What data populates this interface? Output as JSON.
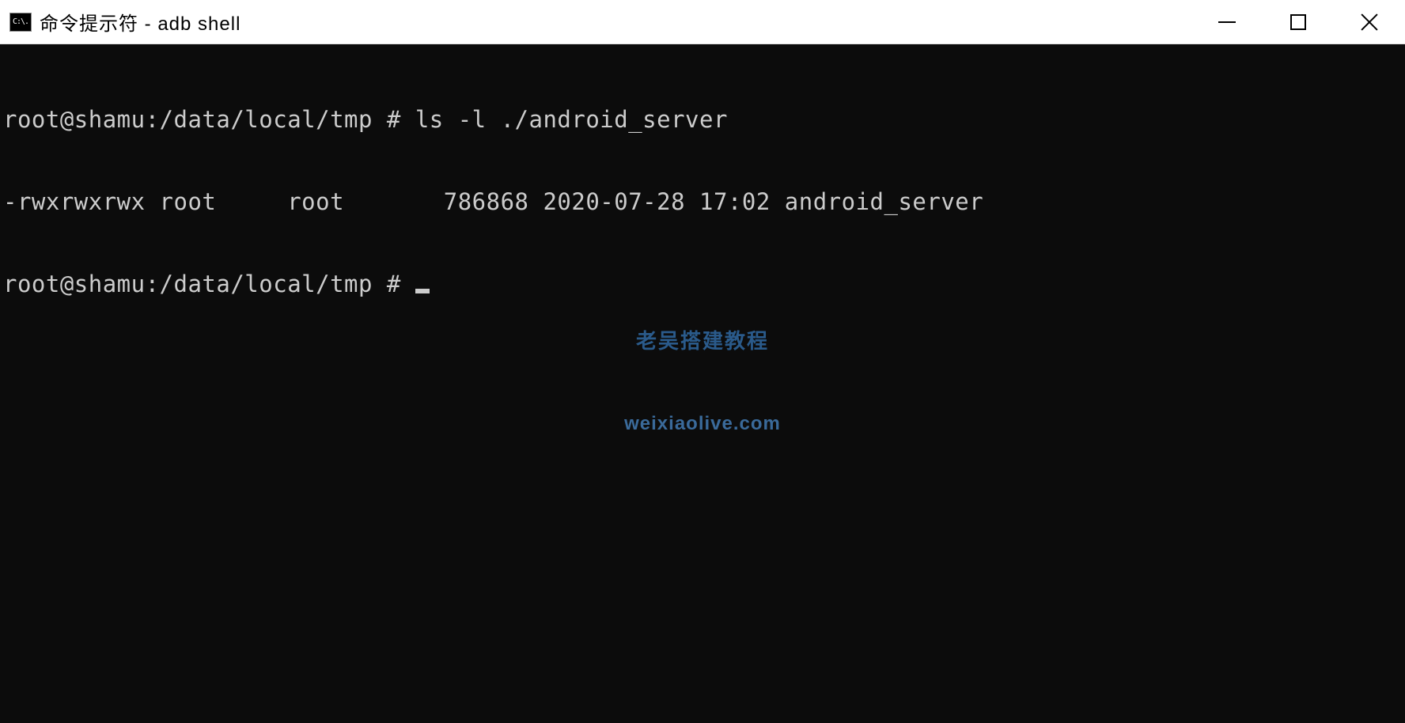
{
  "window": {
    "title": "命令提示符 - adb  shell",
    "icon_label": "C:\\."
  },
  "terminal": {
    "lines": [
      {
        "prompt": "root@shamu:/data/local/tmp # ",
        "command": "ls -l ./android_server"
      },
      {
        "output": "-rwxrwxrwx root     root       786868 2020-07-28 17:02 android_server"
      },
      {
        "prompt": "root@shamu:/data/local/tmp # ",
        "command": ""
      }
    ]
  },
  "watermark": {
    "line1": "老吴搭建教程",
    "line2": "weixiaolive.com"
  }
}
